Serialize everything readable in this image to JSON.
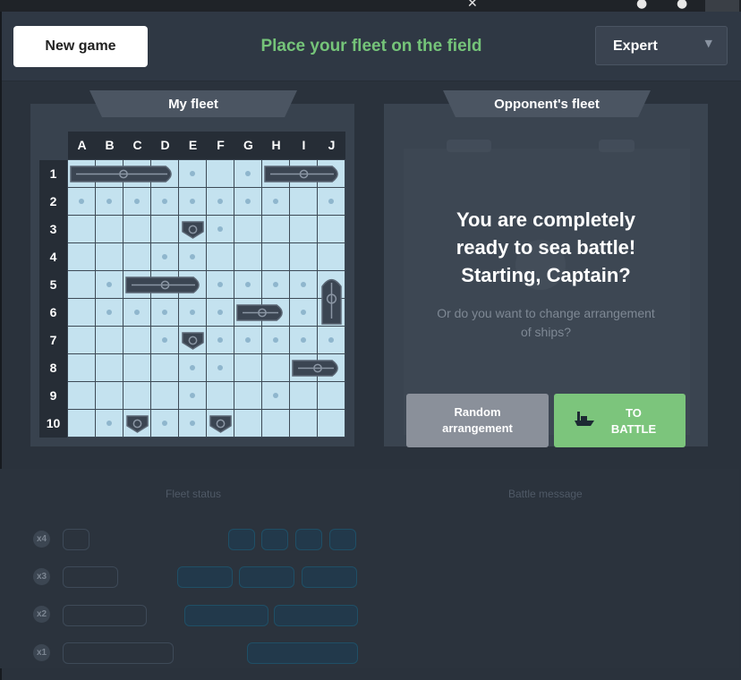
{
  "header": {
    "new_game_label": "New game",
    "headline": "Place your fleet on the field",
    "difficulty": "Expert"
  },
  "my_fleet": {
    "title": "My fleet",
    "columns": [
      "A",
      "B",
      "C",
      "D",
      "E",
      "F",
      "G",
      "H",
      "I",
      "J"
    ],
    "rows": [
      "1",
      "2",
      "3",
      "4",
      "5",
      "6",
      "7",
      "8",
      "9",
      "10"
    ]
  },
  "opponent": {
    "title": "Opponent's fleet",
    "message": [
      "You are completely",
      "ready to sea battle!",
      "Starting, Captain?"
    ],
    "sub": [
      "Or do you want to change arrangement",
      "of ships?"
    ],
    "random_label": [
      "Random",
      "arrangement"
    ],
    "battle_label": [
      "TO",
      "BATTLE"
    ]
  },
  "bottom": {
    "fleet_status": "Fleet status",
    "battle_message": "Battle message",
    "counts": [
      "x4",
      "x3",
      "x2",
      "x1"
    ]
  },
  "colors": {
    "accent_green": "#75c479",
    "water": "#c4e2ef",
    "ship": "#3b4552"
  }
}
